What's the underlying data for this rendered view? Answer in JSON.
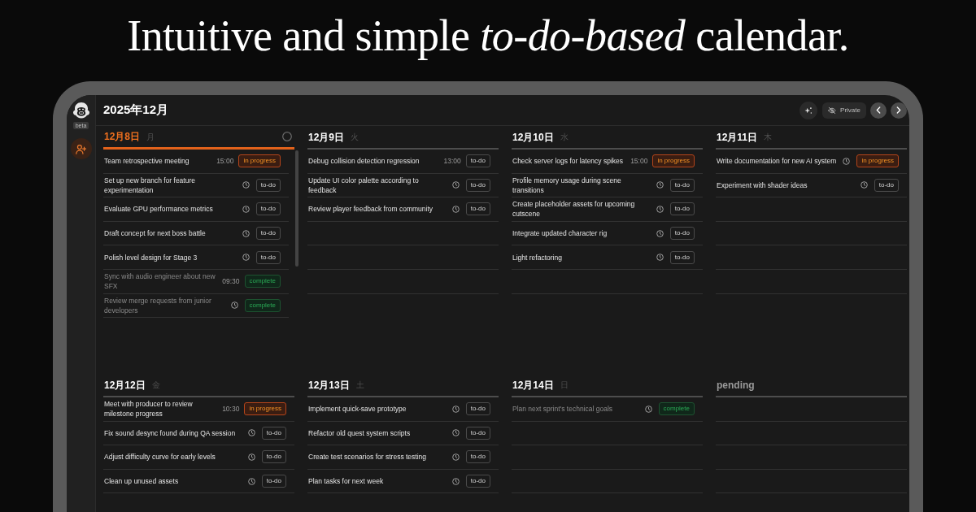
{
  "headline": {
    "text": "Intuitive and simple *to-do-based* calendar."
  },
  "sidebar": {
    "logo_badge": "beta"
  },
  "header": {
    "month": "2025年12月",
    "private_button": "Private"
  },
  "days": [
    {
      "kind": "day",
      "date": "12月8日",
      "weekday": "月",
      "today": true,
      "tasks": [
        {
          "title": "Team retrospective meeting",
          "time": "15:00",
          "badge": "in progress",
          "kind": "active"
        },
        {
          "title": "Set up new branch for feature experimentation",
          "badge": "to-do",
          "kind": "todo"
        },
        {
          "title": "Evaluate GPU performance metrics",
          "badge": "to-do",
          "kind": "todo"
        },
        {
          "title": "Draft concept for next boss battle",
          "badge": "to-do",
          "kind": "todo"
        },
        {
          "title": "Polish level design for Stage 3",
          "badge": "to-do",
          "kind": "todo"
        },
        {
          "title": "Sync with audio engineer about new SFX",
          "time": "09:30",
          "badge": "complete",
          "kind": "done"
        },
        {
          "title": "Review merge requests from junior developers",
          "badge": "complete",
          "kind": "done"
        }
      ]
    },
    {
      "kind": "day",
      "date": "12月9日",
      "weekday": "火",
      "today": false,
      "tasks": [
        {
          "title": "Debug collision detection regression",
          "time": "13:00",
          "badge": "to-do",
          "kind": "todo"
        },
        {
          "title": "Update UI color palette according to feedback",
          "badge": "to-do",
          "kind": "todo"
        },
        {
          "title": "Review player feedback from community",
          "badge": "to-do",
          "kind": "todo"
        }
      ]
    },
    {
      "kind": "day",
      "date": "12月10日",
      "weekday": "水",
      "today": false,
      "tasks": [
        {
          "title": "Check server logs for latency spikes",
          "time": "15:00",
          "badge": "in progress",
          "kind": "active"
        },
        {
          "title": "Profile memory usage during scene transitions",
          "badge": "to-do",
          "kind": "todo"
        },
        {
          "title": "Create placeholder assets for upcoming cutscene",
          "badge": "to-do",
          "kind": "todo"
        },
        {
          "title": "Integrate updated character rig",
          "badge": "to-do",
          "kind": "todo"
        },
        {
          "title": "Light refactoring",
          "badge": "to-do",
          "kind": "todo"
        }
      ]
    },
    {
      "kind": "day",
      "date": "12月11日",
      "weekday": "木",
      "today": false,
      "tasks": [
        {
          "title": "Write documentation for new AI system",
          "badge": "in progress",
          "kind": "active"
        },
        {
          "title": "Experiment with shader ideas",
          "badge": "to-do",
          "kind": "todo"
        }
      ]
    },
    {
      "kind": "day",
      "date": "12月12日",
      "weekday": "金",
      "today": false,
      "tasks": [
        {
          "title": "Meet with producer to review milestone progress",
          "time": "10:30",
          "badge": "in progress",
          "kind": "active"
        },
        {
          "title": "Fix sound desync found during QA session",
          "badge": "to-do",
          "kind": "todo"
        },
        {
          "title": "Adjust difficulty curve for early levels",
          "badge": "to-do",
          "kind": "todo"
        },
        {
          "title": "Clean up unused assets",
          "badge": "to-do",
          "kind": "todo"
        }
      ]
    },
    {
      "kind": "day",
      "date": "12月13日",
      "weekday": "土",
      "today": false,
      "tasks": [
        {
          "title": "Implement quick-save prototype",
          "badge": "to-do",
          "kind": "todo"
        },
        {
          "title": "Refactor old quest system scripts",
          "badge": "to-do",
          "kind": "todo"
        },
        {
          "title": "Create test scenarios for stress testing",
          "badge": "to-do",
          "kind": "todo"
        },
        {
          "title": "Plan tasks for next week",
          "badge": "to-do",
          "kind": "todo"
        }
      ]
    },
    {
      "kind": "day",
      "date": "12月14日",
      "weekday": "日",
      "today": false,
      "tasks": [
        {
          "title": "Plan next sprint's technical goals",
          "badge": "complete",
          "kind": "done"
        }
      ]
    },
    {
      "kind": "backlog",
      "date": "pending"
    }
  ]
}
